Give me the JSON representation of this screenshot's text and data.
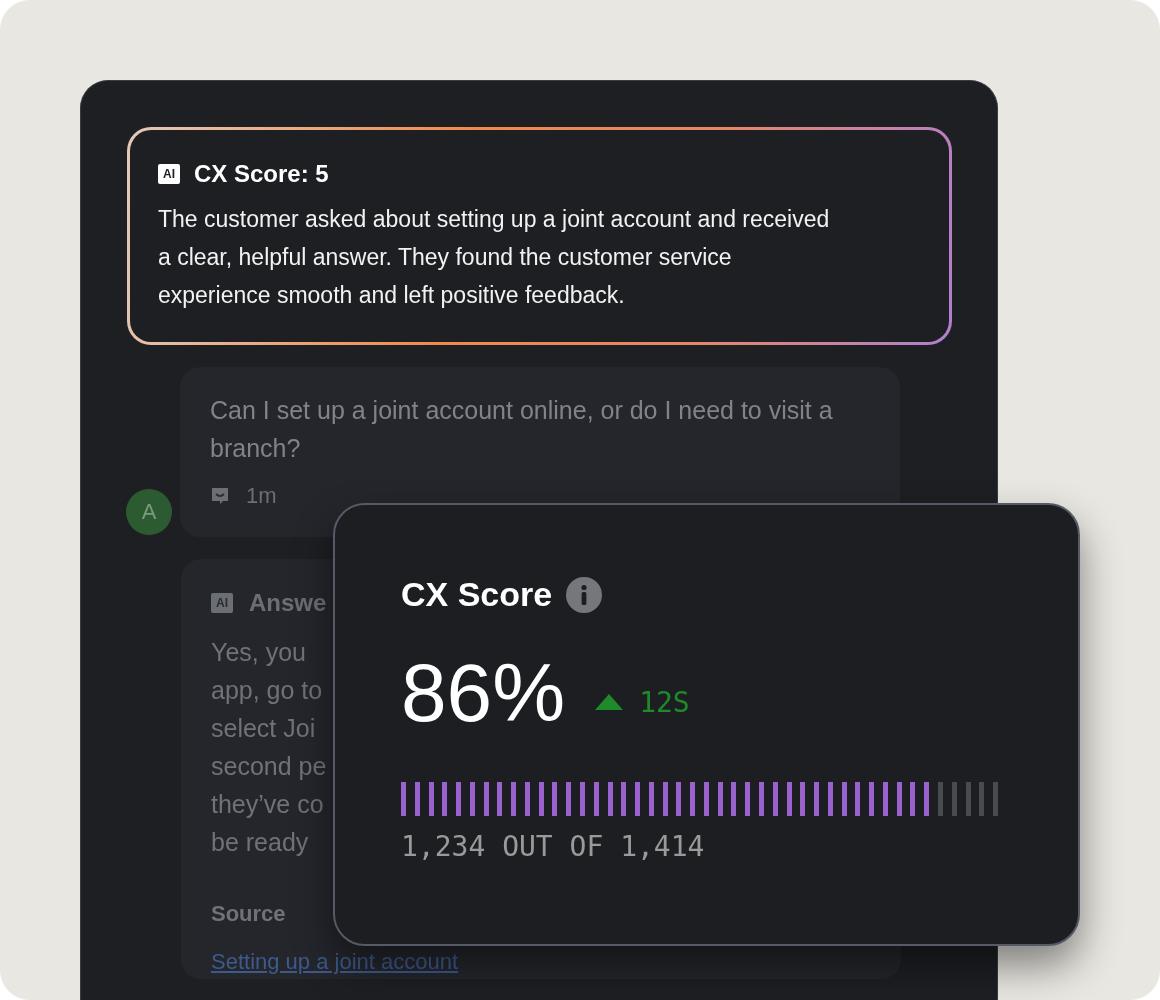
{
  "summary_card": {
    "badge": "AI",
    "title": "CX Score: 5",
    "text": "The customer asked about setting up a joint account and received a clear, helpful answer. They found the customer service experience smooth and left positive feedback."
  },
  "messages": [
    {
      "kind": "question",
      "text": "Can I set up a joint account online, or do I need to visit a branch?",
      "time": "1m",
      "avatar": "A"
    },
    {
      "kind": "answer",
      "badge": "AI",
      "title": "Answe",
      "lines": [
        "Yes, you",
        "app, go to",
        "select Joi",
        "second pe",
        "they’ve co",
        "be ready"
      ],
      "source_label": "Source",
      "source_link": "Setting up a joint account"
    }
  ],
  "score_card": {
    "title": "CX Score",
    "value": "86%",
    "trend_up": true,
    "change": "12S",
    "level": 0.886,
    "count": "1,234 OUT OF 1,414"
  }
}
